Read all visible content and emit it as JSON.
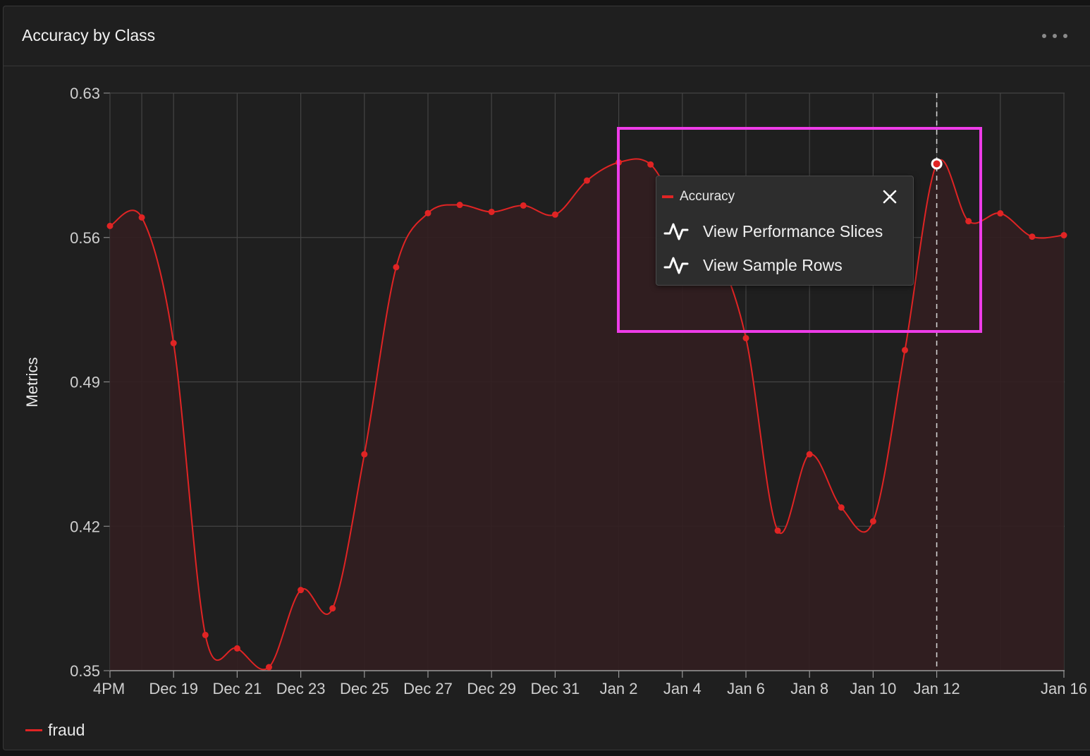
{
  "panel": {
    "title": "Accuracy by Class",
    "menu_icon": "more-horizontal-icon"
  },
  "chart_data": {
    "type": "area",
    "title": "Accuracy by Class",
    "ylabel": "Metrics",
    "xlabel": "",
    "ylim": [
      0.35,
      0.63
    ],
    "yticks": [
      "0.63",
      "0.56",
      "0.49",
      "0.42",
      "0.35"
    ],
    "xticks": [
      "4PM",
      "Dec 19",
      "Dec 21",
      "Dec 23",
      "Dec 25",
      "Dec 27",
      "Dec 29",
      "Dec 31",
      "Jan 2",
      "Jan 4",
      "Jan 6",
      "Jan 8",
      "Jan 10",
      "Jan 12",
      "Jan 16"
    ],
    "grid": true,
    "legend_position": "bottom-left",
    "colors": {
      "series": "#e02424",
      "fill": "#321e20",
      "grid": "#444444",
      "highlight_box": "#ee3ce8"
    },
    "series": [
      {
        "name": "fraud",
        "points": [
          {
            "x": "Dec 17",
            "y": 0.5656
          },
          {
            "x": "Dec 18",
            "y": 0.5697
          },
          {
            "x": "Dec 19",
            "y": 0.5088
          },
          {
            "x": "Dec 20",
            "y": 0.3673
          },
          {
            "x": "Dec 21",
            "y": 0.3608
          },
          {
            "x": "Dec 22",
            "y": 0.3517
          },
          {
            "x": "Dec 23",
            "y": 0.3891
          },
          {
            "x": "Dec 24",
            "y": 0.3802
          },
          {
            "x": "Dec 25",
            "y": 0.4549
          },
          {
            "x": "Dec 26",
            "y": 0.5456
          },
          {
            "x": "Dec 27",
            "y": 0.5718
          },
          {
            "x": "Dec 28",
            "y": 0.5758
          },
          {
            "x": "Dec 29",
            "y": 0.5724
          },
          {
            "x": "Dec 30",
            "y": 0.5755
          },
          {
            "x": "Dec 31",
            "y": 0.5711
          },
          {
            "x": "Jan 1",
            "y": 0.5876
          },
          {
            "x": "Jan 2",
            "y": 0.5964
          },
          {
            "x": "Jan 3",
            "y": 0.5954
          },
          {
            "x": "Jan 4",
            "y": 0.57
          },
          {
            "x": "Jan 5",
            "y": 0.555
          },
          {
            "x": "Jan 6",
            "y": 0.5112
          },
          {
            "x": "Jan 7",
            "y": 0.4179
          },
          {
            "x": "Jan 8",
            "y": 0.4549
          },
          {
            "x": "Jan 9",
            "y": 0.4291
          },
          {
            "x": "Jan 10",
            "y": 0.4224
          },
          {
            "x": "Jan 11",
            "y": 0.5054
          },
          {
            "x": "Jan 12",
            "y": 0.5957
          },
          {
            "x": "Jan 13",
            "y": 0.5679
          },
          {
            "x": "Jan 14",
            "y": 0.5717
          },
          {
            "x": "Jan 15",
            "y": 0.5604
          },
          {
            "x": "Jan 16",
            "y": 0.5611
          }
        ]
      }
    ],
    "hovered_x": "Jan 12",
    "tooltip": {
      "series_label": "Accuracy",
      "close_icon": "close-icon",
      "actions": [
        {
          "label": "View Performance Slices",
          "icon": "activity-icon"
        },
        {
          "label": "View Sample Rows",
          "icon": "activity-icon"
        }
      ]
    }
  },
  "legend": {
    "items": [
      {
        "label": "fraud",
        "color": "#e02424"
      }
    ]
  }
}
